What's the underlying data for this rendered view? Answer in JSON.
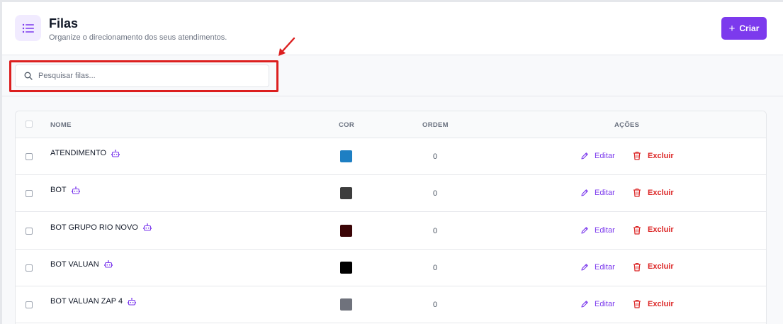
{
  "header": {
    "title": "Filas",
    "subtitle": "Organize o direcionamento dos seus atendimentos.",
    "create_label": "Criar"
  },
  "search": {
    "placeholder": "Pesquisar filas..."
  },
  "table": {
    "columns": [
      "NOME",
      "COR",
      "ORDEM",
      "AÇÕES"
    ],
    "edit_label": "Editar",
    "delete_label": "Excluir",
    "rows": [
      {
        "name": "ATENDIMENTO",
        "color": "#1e7fc3",
        "order": "0"
      },
      {
        "name": "BOT",
        "color": "#3d3d3d",
        "order": "0"
      },
      {
        "name": "BOT GRUPO RIO NOVO",
        "color": "#3b0507",
        "order": "0"
      },
      {
        "name": "BOT VALUAN",
        "color": "#000000",
        "order": "0"
      },
      {
        "name": "BOT VALUAN ZAP 4",
        "color": "#6f727c",
        "order": "0"
      }
    ]
  },
  "colors": {
    "accent": "#7c3aed",
    "danger": "#dc2626",
    "highlight": "#dc1f1f"
  },
  "icons": {
    "header": "list-icon",
    "search": "search-icon",
    "row_tag": "robot-icon",
    "edit": "pencil-icon",
    "delete": "trash-icon",
    "annotation": "red-arrow"
  }
}
